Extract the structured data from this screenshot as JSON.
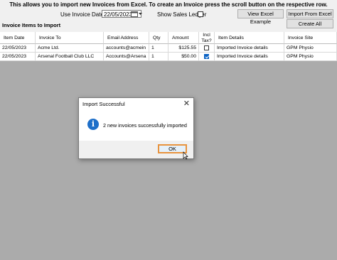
{
  "header": {
    "text": "This allows you to import new Invoices from Excel. To create an Invoice press the scroll button on the respective row."
  },
  "toolbar": {
    "use_invoice_date_label": "Use Invoice Date",
    "invoice_date_value": "22/05/2023",
    "show_sales_ledger_label": "Show Sales Ledger",
    "show_sales_ledger_checked": false,
    "view_excel_example_label": "View Excel Example",
    "import_from_excel_label": "Import From Excel",
    "create_all_label": "Create All"
  },
  "section": {
    "title": "Invoice Items to Import"
  },
  "grid": {
    "columns": [
      "Item Date",
      "Invoice To",
      "Email Address",
      "Qty",
      "Amount",
      "Incl Tax?",
      "Item Details",
      "Invoice Site"
    ],
    "rows": [
      {
        "date": "22/05/2023",
        "invoice_to": "Acme Ltd.",
        "email": "accounts@acmein",
        "qty": "1",
        "amount": "$125.55",
        "incl_tax": false,
        "details": "Imported Invoice details",
        "site": "GPM Physio"
      },
      {
        "date": "22/05/2023",
        "invoice_to": "Arsenal Football Club LLC",
        "email": "Accounts@Arsena",
        "qty": "1",
        "amount": "$50.00",
        "incl_tax": true,
        "details": "Imported Invoice details",
        "site": "GPM Physio"
      }
    ]
  },
  "dialog": {
    "title": "Import Successful",
    "message": "2 new invoices successfully imported",
    "ok_label": "OK",
    "icon": "info-icon",
    "close_icon": "close-icon"
  },
  "colors": {
    "accent": "#0b62c4",
    "ok_highlight": "#e8933e",
    "grid_bg": "#ababab"
  }
}
